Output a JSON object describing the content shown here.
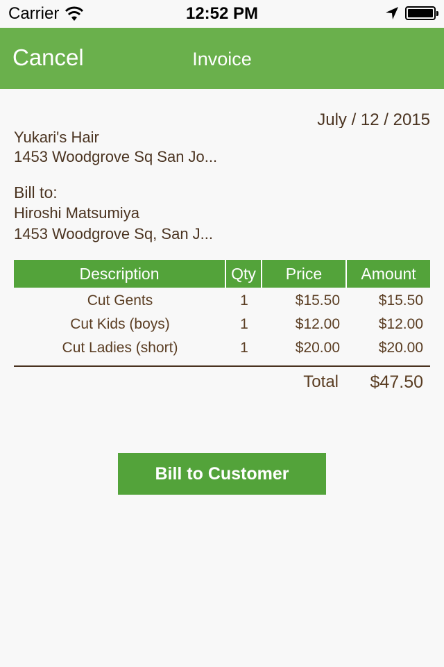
{
  "status_bar": {
    "carrier": "Carrier",
    "time": "12:52 PM",
    "icons": [
      "wifi-icon",
      "location-arrow-icon",
      "battery-icon"
    ]
  },
  "nav": {
    "cancel_label": "Cancel",
    "title": "Invoice",
    "color": "#6ab04c"
  },
  "invoice": {
    "date": "July / 12 / 2015",
    "business_name": "Yukari's Hair",
    "business_address": "1453 Woodgrove Sq San Jo...",
    "bill_to_label": "Bill to:",
    "customer_name": "Hiroshi Matsumiya",
    "customer_address": "1453 Woodgrove Sq, San J..."
  },
  "table": {
    "headers": [
      "Description",
      "Qty",
      "Price",
      "Amount"
    ],
    "rows": [
      {
        "description": "Cut Gents",
        "qty": "1",
        "price": "$15.50",
        "amount": "$15.50"
      },
      {
        "description": "Cut Kids (boys)",
        "qty": "1",
        "price": "$12.00",
        "amount": "$12.00"
      },
      {
        "description": "Cut Ladies (short)",
        "qty": "1",
        "price": "$20.00",
        "amount": "$20.00"
      }
    ],
    "total_label": "Total",
    "total_value": "$47.50",
    "header_color": "#53a33a"
  },
  "actions": {
    "bill_button_label": "Bill to Customer"
  }
}
